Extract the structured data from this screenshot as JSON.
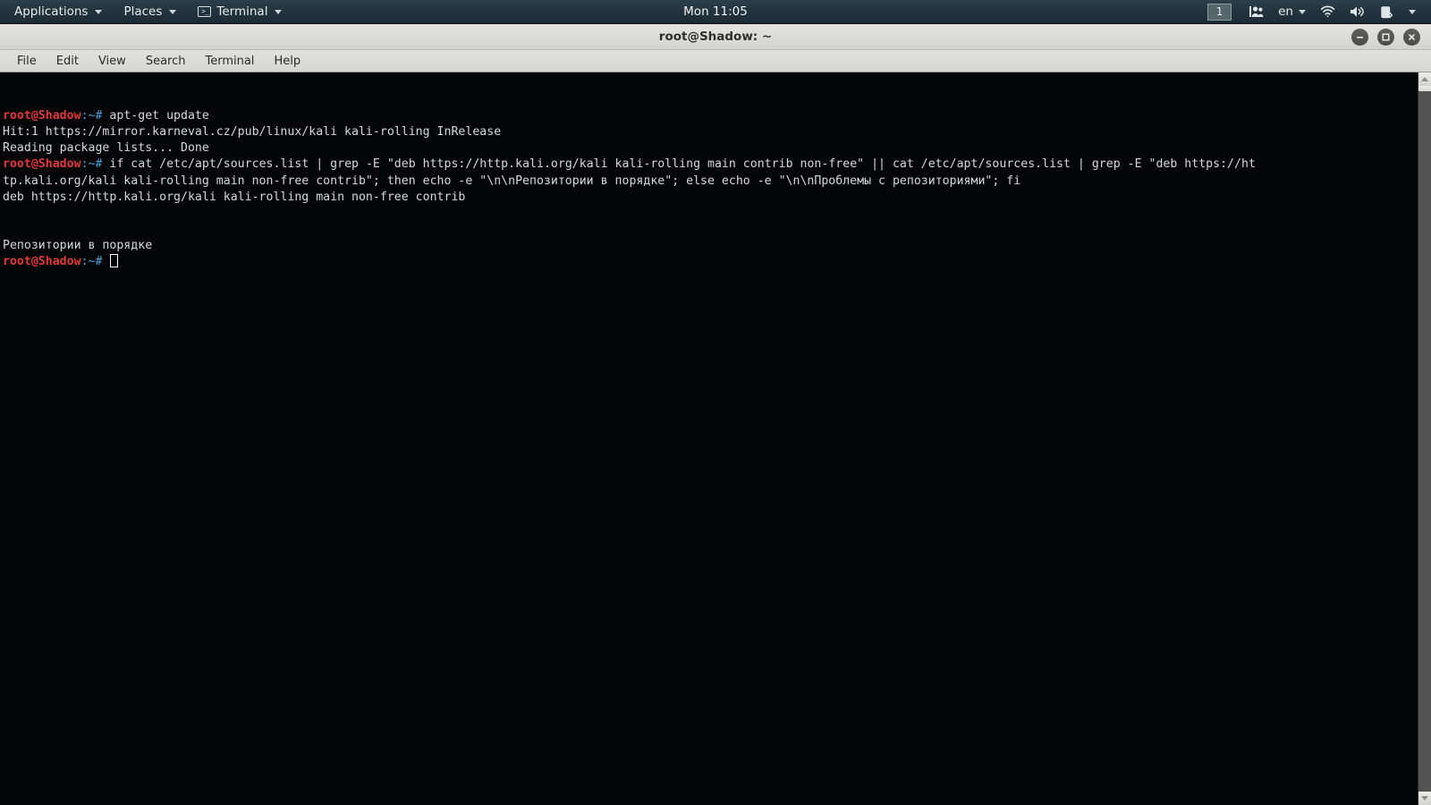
{
  "panel": {
    "menus": [
      {
        "label": "Applications",
        "icon": "none"
      },
      {
        "label": "Places",
        "icon": "none"
      },
      {
        "label": "Terminal",
        "icon": "terminal-icon"
      }
    ],
    "clock": "Mon 11:05",
    "workspace": "1",
    "language": "en",
    "tray": [
      {
        "name": "users-icon",
        "glyph": "👥"
      },
      {
        "name": "wifi-icon",
        "glyph": "wifi"
      },
      {
        "name": "volume-icon",
        "glyph": "volume"
      },
      {
        "name": "battery-icon",
        "glyph": "battery"
      },
      {
        "name": "chevron-down-icon",
        "glyph": "caret"
      }
    ]
  },
  "window": {
    "title": "root@Shadow: ~",
    "buttons": {
      "minimize": "–",
      "maximize": "□",
      "close": "×"
    },
    "menu_items": [
      "File",
      "Edit",
      "View",
      "Search",
      "Terminal",
      "Help"
    ]
  },
  "terminal": {
    "prompt_user": "root@Shadow",
    "prompt_host": ":~#",
    "lines": [
      {
        "type": "prompt",
        "command": " apt-get update"
      },
      {
        "type": "output",
        "text": "Hit:1 https://mirror.karneval.cz/pub/linux/kali kali-rolling InRelease"
      },
      {
        "type": "output",
        "text": "Reading package lists... Done"
      },
      {
        "type": "prompt",
        "command": " if cat /etc/apt/sources.list | grep -E \"deb https://http.kali.org/kali kali-rolling main contrib non-free\" || cat /etc/apt/sources.list | grep -E \"deb https://ht"
      },
      {
        "type": "output",
        "text": "tp.kali.org/kali kali-rolling main non-free contrib\"; then echo -e \"\\n\\nРепозитории в порядке\"; else echo -e \"\\n\\nПроблемы с репозиториями\"; fi"
      },
      {
        "type": "output",
        "text": "deb https://http.kali.org/kali kali-rolling main non-free contrib"
      },
      {
        "type": "output",
        "text": ""
      },
      {
        "type": "output",
        "text": ""
      },
      {
        "type": "output",
        "text": "Репозитории в порядке"
      },
      {
        "type": "prompt-cursor",
        "command": " "
      }
    ]
  },
  "colors": {
    "prompt_user": "#e23a3a",
    "prompt_host": "#4a9fd4",
    "terminal_text": "#d8d8d8",
    "panel_bg": "#23333d",
    "titlebar_bg": "#dcdcda",
    "wallpaper_accent": "#12283a"
  }
}
